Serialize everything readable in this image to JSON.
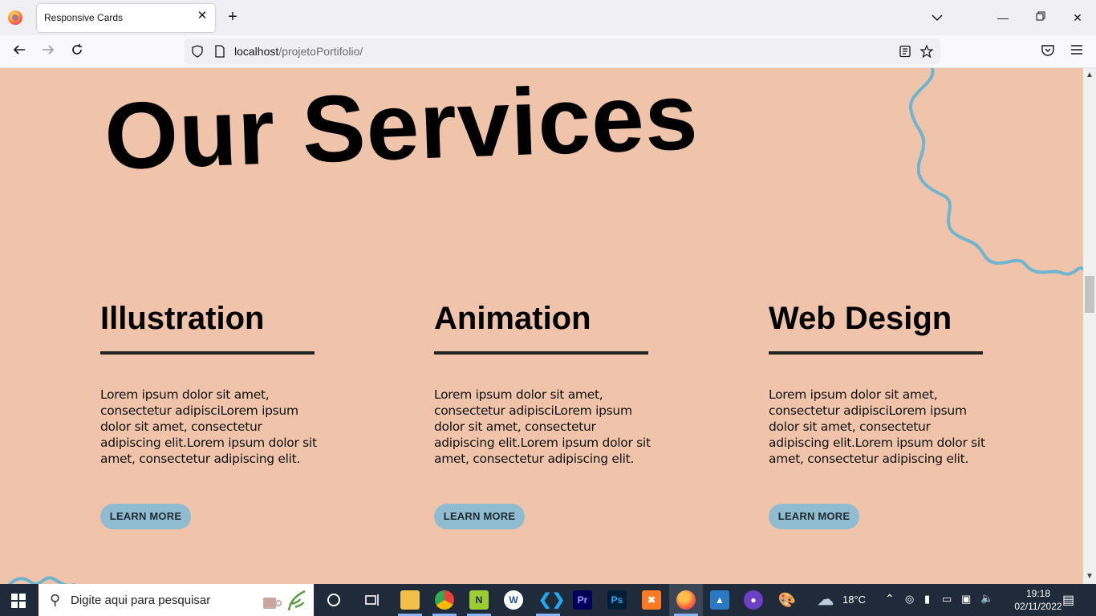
{
  "browser": {
    "tab_title": "Responsive Cards",
    "url_host": "localhost",
    "url_path": "/projetoPortifolio/"
  },
  "page": {
    "title": "Our Services",
    "cards": [
      {
        "heading": "Illustration",
        "body": "Lorem ipsum dolor sit amet, consectetur adipisciLorem ipsum dolor sit amet, consectetur adipiscing elit.Lorem ipsum dolor sit amet, consectetur adipiscing elit.",
        "button": "LEARN MORE"
      },
      {
        "heading": "Animation",
        "body": "Lorem ipsum dolor sit amet, consectetur adipisciLorem ipsum dolor sit amet, consectetur adipiscing elit.Lorem ipsum dolor sit amet, consectetur adipiscing elit.",
        "button": "LEARN MORE"
      },
      {
        "heading": "Web Design",
        "body": "Lorem ipsum dolor sit amet, consectetur adipisciLorem ipsum dolor sit amet, consectetur adipiscing elit.Lorem ipsum dolor sit amet, consectetur adipiscing elit.",
        "button": "LEARN MORE"
      }
    ],
    "colors": {
      "background": "#f0c4aa",
      "accent": "#8fbcd1",
      "squiggle": "#6db5d1"
    }
  },
  "taskbar": {
    "search_placeholder": "Digite aqui para pesquisar",
    "weather": "18°C",
    "time": "19:18",
    "date": "02/11/2022",
    "apps": [
      "file-explorer-icon",
      "chrome-icon",
      "notepadpp-icon",
      "wordpad-icon",
      "vscode-icon",
      "premiere-icon",
      "photoshop-icon",
      "xampp-icon",
      "firefox-icon",
      "photos-icon",
      "github-icon",
      "paint-icon"
    ]
  }
}
